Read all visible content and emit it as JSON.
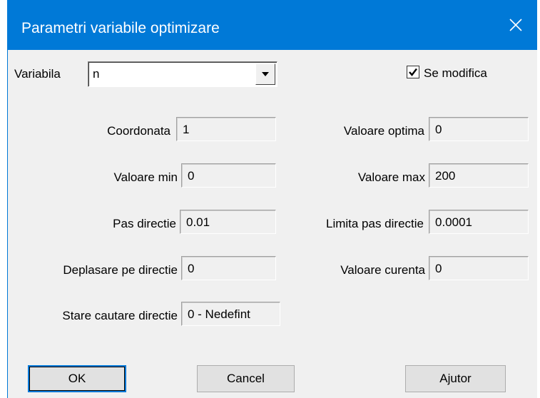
{
  "window": {
    "title": "Parametri variabile optimizare",
    "close_icon": "close-icon"
  },
  "variabila": {
    "label": "Variabila",
    "value": "n",
    "dropdown_icon": "chevron-down-icon"
  },
  "se_modifica": {
    "label": "Se modifica",
    "checked": true
  },
  "fields": {
    "coordonata": {
      "label": "Coordonata",
      "value": "1"
    },
    "valoare_optima": {
      "label": "Valoare optima",
      "value": "0"
    },
    "valoare_min": {
      "label": "Valoare min",
      "value": "0"
    },
    "valoare_max": {
      "label": "Valoare max",
      "value": "200"
    },
    "pas_directie": {
      "label": "Pas directie",
      "value": "0.01"
    },
    "limita_pas_directie": {
      "label": "Limita pas directie",
      "value": "0.0001"
    },
    "deplasare_pe_directie": {
      "label": "Deplasare pe directie",
      "value": "0"
    },
    "valoare_curenta": {
      "label": "Valoare curenta",
      "value": "0"
    },
    "stare_cautare_directie": {
      "label": "Stare cautare directie",
      "value": "0 - Nedefint"
    }
  },
  "buttons": {
    "ok": "OK",
    "cancel": "Cancel",
    "help": "Ajutor"
  },
  "colors": {
    "titlebar": "#0079d7",
    "dialog_bg": "#f0f0f0"
  }
}
